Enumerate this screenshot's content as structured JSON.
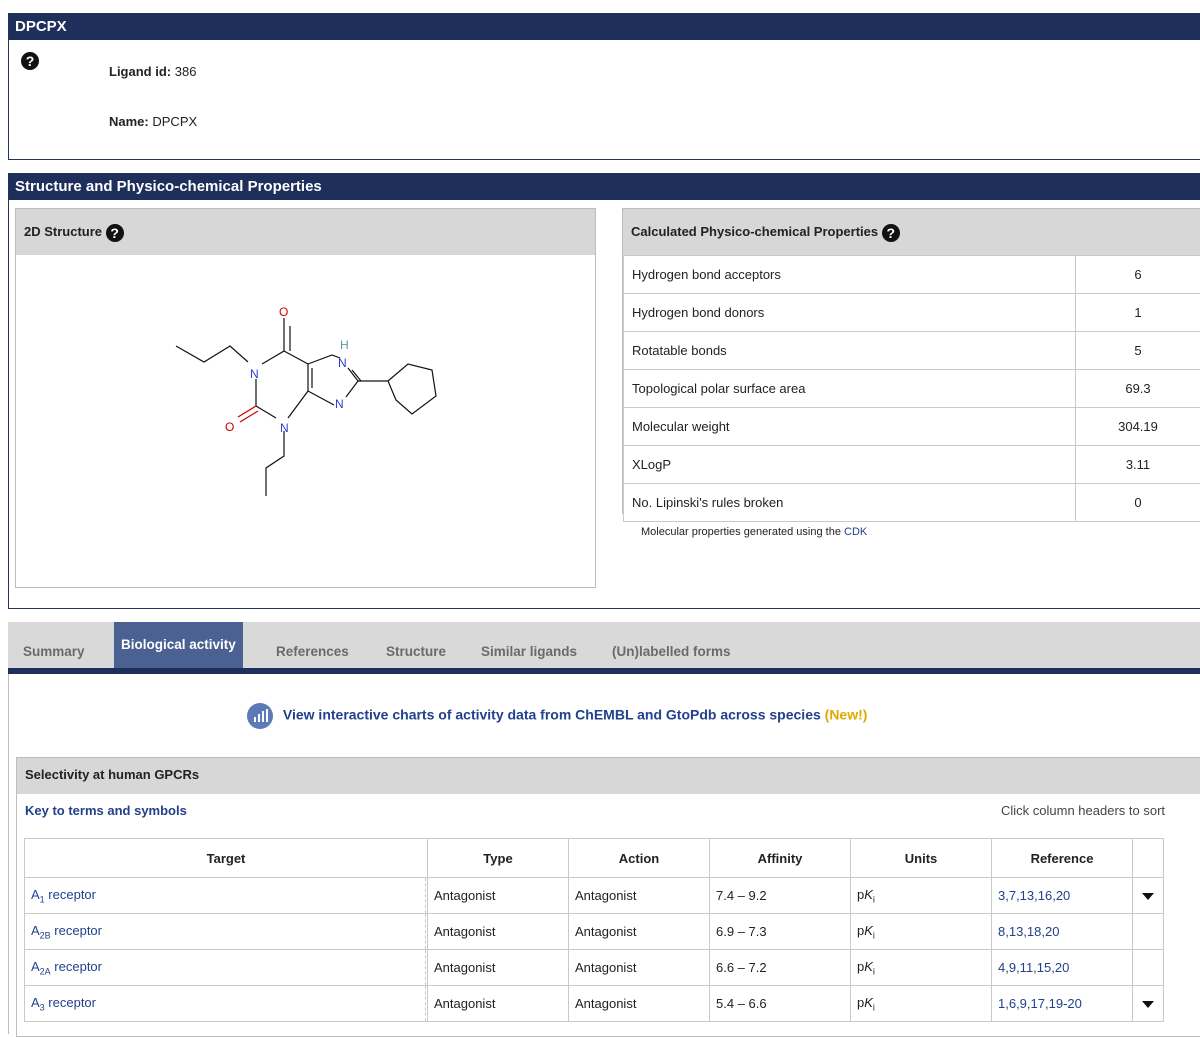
{
  "ligand_panel": {
    "title": "DPCPX",
    "id_label": "Ligand id:",
    "id_value": "386",
    "name_label": "Name:",
    "name_value": "DPCPX"
  },
  "structure_panel": {
    "title": "Structure and Physico-chemical Properties",
    "structure_box_title": "2D Structure",
    "atoms": {
      "o1": "O",
      "o2": "O",
      "n1": "N",
      "n2": "N",
      "n3": "N",
      "n4": "N",
      "h": "H"
    },
    "props_title": "Calculated Physico-chemical Properties",
    "properties": [
      {
        "label": "Hydrogen bond acceptors",
        "value": "6"
      },
      {
        "label": "Hydrogen bond donors",
        "value": "1"
      },
      {
        "label": "Rotatable bonds",
        "value": "5"
      },
      {
        "label": "Topological polar surface area",
        "value": "69.3"
      },
      {
        "label": "Molecular weight",
        "value": "304.19"
      },
      {
        "label": "XLogP",
        "value": "3.11"
      },
      {
        "label": "No. Lipinski's rules broken",
        "value": "0"
      }
    ],
    "cdk_note_prefix": "Molecular properties generated using the",
    "cdk_link": "CDK"
  },
  "tabs": [
    {
      "label": "Summary",
      "active": false
    },
    {
      "label": "Biological activity",
      "active": true
    },
    {
      "label": "References",
      "active": false
    },
    {
      "label": "Structure",
      "active": false
    },
    {
      "label": "Similar ligands",
      "active": false
    },
    {
      "label": "(Un)labelled forms",
      "active": false
    }
  ],
  "activity": {
    "charts_link": "View interactive charts of activity data from ChEMBL and GtoPdb across species",
    "new_tag": "(New!)",
    "section_title": "Selectivity at human GPCRs",
    "key_link": "Key to terms and symbols",
    "sort_hint": "Click column headers to sort",
    "columns": [
      "Target",
      "Type",
      "Action",
      "Affinity",
      "Units",
      "Reference"
    ],
    "rows": [
      {
        "target_main": "A",
        "target_sub": "1",
        "target_rest": " receptor",
        "type": "Antagonist",
        "action": "Antagonist",
        "affinity": "7.4 – 9.2",
        "units_p": "p",
        "units_k": "K",
        "units_i": "i",
        "reference": "3,7,13,16,20",
        "expand": true
      },
      {
        "target_main": "A",
        "target_sub": "2B",
        "target_rest": " receptor",
        "type": "Antagonist",
        "action": "Antagonist",
        "affinity": "6.9 – 7.3",
        "units_p": "p",
        "units_k": "K",
        "units_i": "i",
        "reference": "8,13,18,20",
        "expand": false
      },
      {
        "target_main": "A",
        "target_sub": "2A",
        "target_rest": " receptor",
        "type": "Antagonist",
        "action": "Antagonist",
        "affinity": "6.6 – 7.2",
        "units_p": "p",
        "units_k": "K",
        "units_i": "i",
        "reference": "4,9,11,15,20",
        "expand": false
      },
      {
        "target_main": "A",
        "target_sub": "3",
        "target_rest": " receptor",
        "type": "Antagonist",
        "action": "Antagonist",
        "affinity": "5.4 – 6.6",
        "units_p": "p",
        "units_k": "K",
        "units_i": "i",
        "reference": "1,6,9,17,19-20",
        "expand": true
      }
    ]
  },
  "colors": {
    "header_bg": "#1f2f5c",
    "tab_active_bg": "#4a6192",
    "link": "#22418c",
    "new_tag": "#e0a800"
  }
}
